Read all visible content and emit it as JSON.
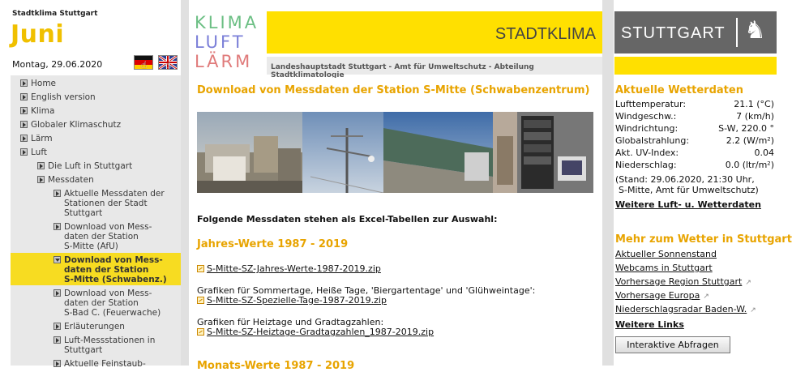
{
  "site": {
    "name": "Stadtklima Stuttgart",
    "month": "Juni",
    "date": "Montag, 29.06.2020"
  },
  "nav": [
    {
      "label": "Home",
      "level": 0,
      "active": false
    },
    {
      "label": "English version",
      "level": 0,
      "active": false
    },
    {
      "label": "Klima",
      "level": 0,
      "active": false
    },
    {
      "label": "Globaler Klimaschutz",
      "level": 0,
      "active": false
    },
    {
      "label": "Lärm",
      "level": 0,
      "active": false
    },
    {
      "label": "Luft",
      "level": 0,
      "active": false
    },
    {
      "label": "Die Luft in Stuttgart",
      "level": 1,
      "active": false
    },
    {
      "label": "Messdaten",
      "level": 1,
      "active": false
    },
    {
      "label": "Aktuelle Messdaten der\nStationen der Stadt\nStuttgart",
      "level": 2,
      "active": false
    },
    {
      "label": "Download von Mess-\ndaten der Station\nS-Mitte (AfU)",
      "level": 2,
      "active": false
    },
    {
      "label": "Download von Mess-\ndaten der Station\nS-Mitte (Schwabenz.)",
      "level": 2,
      "active": true
    },
    {
      "label": "Download von Mess-\ndaten der Station\nS-Bad C. (Feuerwache)",
      "level": 2,
      "active": false
    },
    {
      "label": "Erläuterungen",
      "level": 2,
      "active": false
    },
    {
      "label": "Luft-Messstationen in\nStuttgart",
      "level": 2,
      "active": false
    },
    {
      "label": "Aktuelle Feinstaub-",
      "level": 2,
      "active": false
    }
  ],
  "header": {
    "logo_words": [
      "KLIMA",
      "LUFT",
      "LÄRM"
    ],
    "logo_colors": [
      "#6cbf84",
      "#7b7fd8",
      "#e07b7b"
    ],
    "banner_title": "STADTKLIMA",
    "subline": "Landeshauptstadt Stuttgart - Amt für Umweltschutz - Abteilung Stadtklimatologie"
  },
  "main": {
    "heading": "Download von Messdaten der Station S-Mitte (Schwabenzentrum)",
    "intro": "Folgende Messdaten stehen als Excel-Tabellen zur Auswahl:",
    "section1": "Jahres-Werte 1987 - 2019",
    "file1": "S-Mitte-SZ-Jahres-Werte-1987-2019.zip",
    "caption2": "Grafiken für Sommertage, Heiße Tage, 'Biergartentage' und 'Glühweintage':",
    "file2": "S-Mitte-SZ-Spezielle-Tage-1987-2019.zip",
    "caption3": "Grafiken für Heiztage und Gradtagzahlen:",
    "file3": "S-Mitte-SZ-Heiztage-Gradtagzahlen_1987-2019.zip",
    "section2": "Monats-Werte 1987 - 2019"
  },
  "right": {
    "city_logo_text": "STUTTGART",
    "weather_heading": "Aktuelle Wetterdaten",
    "weather": [
      {
        "label": "Lufttemperatur:",
        "value": "21.1 (°C)"
      },
      {
        "label": "Windgeschw.:",
        "value": "7 (km/h)"
      },
      {
        "label": "Windrichtung:",
        "value": "S-W, 220.0 °"
      },
      {
        "label": "Globalstrahlung:",
        "value": "2.2 (W/m²)"
      },
      {
        "label": "Akt. UV-Index:",
        "value": "0.04"
      },
      {
        "label": "Niederschlag:",
        "value": "0.0 (ltr/m²)"
      }
    ],
    "stand_line1": "(Stand: 29.06.2020, 21:30 Uhr,",
    "stand_line2": "S-Mitte, Amt für Umweltschutz)",
    "more_weather_link": "Weitere Luft- u. Wetterdaten",
    "mehr_heading": "Mehr zum Wetter in Stuttgart",
    "links": [
      {
        "label": "Aktueller Sonnenstand",
        "external": false
      },
      {
        "label": "Webcams in Stuttgart",
        "external": false
      },
      {
        "label": "Vorhersage Region Stuttgart",
        "external": true
      },
      {
        "label": "Vorhersage Europa",
        "external": true
      },
      {
        "label": "Niederschlagsradar Baden-W.",
        "external": true
      }
    ],
    "more_links": "Weitere Links",
    "button": "Interaktive Abfragen"
  }
}
